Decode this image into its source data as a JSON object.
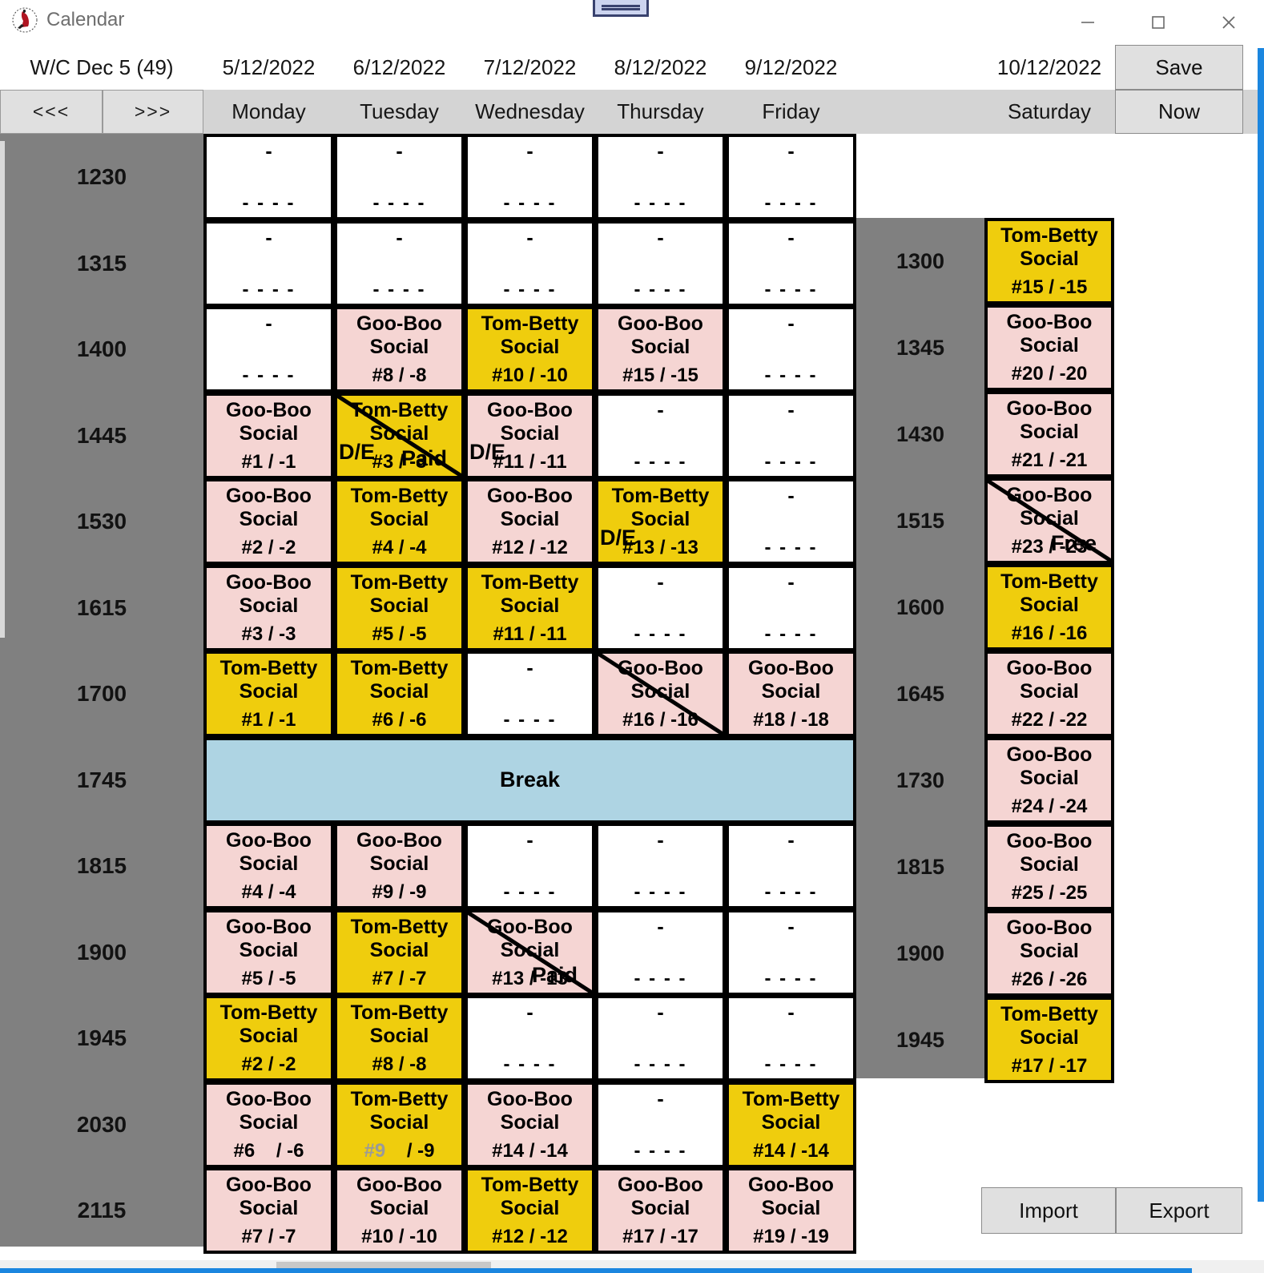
{
  "window": {
    "title": "Calendar",
    "minimize": "minimize-icon",
    "maximize": "maximize-icon",
    "close": "close-icon"
  },
  "header": {
    "week_label": "W/C Dec 5 (49)",
    "prev_label": "<<<",
    "next_label": ">>>",
    "save_label": "Save",
    "now_label": "Now",
    "import_label": "Import",
    "export_label": "Export",
    "dates": [
      "5/12/2022",
      "6/12/2022",
      "7/12/2022",
      "8/12/2022",
      "9/12/2022",
      "10/12/2022"
    ],
    "days": [
      "Monday",
      "Tuesday",
      "Wednesday",
      "Thursday",
      "Friday",
      "Saturday"
    ]
  },
  "weekday_times": [
    "1230",
    "1315",
    "1400",
    "1445",
    "1530",
    "1615",
    "1700",
    "1745",
    "1815",
    "1900",
    "1945",
    "2030",
    "2115"
  ],
  "saturday_times": [
    "1300",
    "1345",
    "1430",
    "1515",
    "1600",
    "1645",
    "1730",
    "1815",
    "1900",
    "1945"
  ],
  "empty_cell": {
    "title": "-",
    "num": "- - - -"
  },
  "break_label": "Break",
  "rows": [
    {
      "time": "1230",
      "cells": [
        {
          "kind": "empty"
        },
        {
          "kind": "empty"
        },
        {
          "kind": "empty"
        },
        {
          "kind": "empty"
        },
        {
          "kind": "empty"
        }
      ]
    },
    {
      "time": "1315",
      "cells": [
        {
          "kind": "empty"
        },
        {
          "kind": "empty"
        },
        {
          "kind": "empty"
        },
        {
          "kind": "empty"
        },
        {
          "kind": "empty"
        }
      ]
    },
    {
      "time": "1400",
      "cells": [
        {
          "kind": "empty"
        },
        {
          "kind": "pink",
          "title": "Goo-Boo Social",
          "num": "#8 / -8"
        },
        {
          "kind": "yellow",
          "title": "Tom-Betty Social",
          "num": "#10 / -10"
        },
        {
          "kind": "pink",
          "title": "Goo-Boo Social",
          "num": "#15 / -15"
        },
        {
          "kind": "empty"
        }
      ]
    },
    {
      "time": "1445",
      "cells": [
        {
          "kind": "pink",
          "title": "Goo-Boo Social",
          "num": "#1 / -1"
        },
        {
          "kind": "yellow",
          "title": "Tom-Betty Social",
          "num": "#3 / -3",
          "strike": true,
          "tag_left": "D/E",
          "tag_right": "Paid"
        },
        {
          "kind": "pink",
          "title": "Goo-Boo Social",
          "num": "#11 / -11",
          "tag_left": "D/E"
        },
        {
          "kind": "empty"
        },
        {
          "kind": "empty"
        }
      ]
    },
    {
      "time": "1530",
      "cells": [
        {
          "kind": "pink",
          "title": "Goo-Boo Social",
          "num": "#2 / -2"
        },
        {
          "kind": "yellow",
          "title": "Tom-Betty Social",
          "num": "#4 / -4"
        },
        {
          "kind": "pink",
          "title": "Goo-Boo Social",
          "num": "#12 / -12"
        },
        {
          "kind": "yellow",
          "title": "Tom-Betty Social",
          "num": "#13 / -13",
          "tag_left": "D/E"
        },
        {
          "kind": "empty"
        }
      ]
    },
    {
      "time": "1615",
      "cells": [
        {
          "kind": "pink",
          "title": "Goo-Boo Social",
          "num": "#3 / -3"
        },
        {
          "kind": "yellow",
          "title": "Tom-Betty Social",
          "num": "#5 / -5"
        },
        {
          "kind": "yellow",
          "title": "Tom-Betty Social",
          "num": "#11 / -11"
        },
        {
          "kind": "empty"
        },
        {
          "kind": "empty"
        }
      ]
    },
    {
      "time": "1700",
      "cells": [
        {
          "kind": "yellow",
          "title": "Tom-Betty Social",
          "num": "#1 / -1"
        },
        {
          "kind": "yellow",
          "title": "Tom-Betty Social",
          "num": "#6 / -6"
        },
        {
          "kind": "empty"
        },
        {
          "kind": "pink",
          "title": "Goo-Boo Social",
          "num": "#16 / -16",
          "strike": true
        },
        {
          "kind": "pink",
          "title": "Goo-Boo Social",
          "num": "#18 / -18"
        }
      ]
    },
    {
      "time": "1745",
      "break": true
    },
    {
      "time": "1815",
      "cells": [
        {
          "kind": "pink",
          "title": "Goo-Boo Social",
          "num": "#4 / -4"
        },
        {
          "kind": "pink",
          "title": "Goo-Boo Social",
          "num": "#9 / -9"
        },
        {
          "kind": "empty"
        },
        {
          "kind": "empty"
        },
        {
          "kind": "empty"
        }
      ]
    },
    {
      "time": "1900",
      "cells": [
        {
          "kind": "pink",
          "title": "Goo-Boo Social",
          "num": "#5 / -5"
        },
        {
          "kind": "yellow",
          "title": "Tom-Betty Social",
          "num": "#7 / -7"
        },
        {
          "kind": "pink",
          "title": "Goo-Boo Social",
          "num": "#13 / -13",
          "strike": true,
          "tag_right": "Paid"
        },
        {
          "kind": "empty"
        },
        {
          "kind": "empty"
        }
      ]
    },
    {
      "time": "1945",
      "cells": [
        {
          "kind": "yellow",
          "title": "Tom-Betty Social",
          "num": "#2 / -2"
        },
        {
          "kind": "yellow",
          "title": "Tom-Betty Social",
          "num": "#8 / -8"
        },
        {
          "kind": "empty"
        },
        {
          "kind": "empty"
        },
        {
          "kind": "empty"
        }
      ]
    },
    {
      "time": "2030",
      "cells": [
        {
          "kind": "pink",
          "title": "Goo-Boo Social",
          "num": "#6    / -6"
        },
        {
          "kind": "yellow",
          "title": "Tom-Betty Social",
          "num_gray": "#9",
          "num": "    / -9"
        },
        {
          "kind": "pink",
          "title": "Goo-Boo Social",
          "num": "#14 / -14"
        },
        {
          "kind": "empty"
        },
        {
          "kind": "yellow",
          "title": "Tom-Betty Social",
          "num": "#14 / -14"
        }
      ]
    },
    {
      "time": "2115",
      "cells": [
        {
          "kind": "pink",
          "title": "Goo-Boo Social",
          "num": "#7 / -7"
        },
        {
          "kind": "pink",
          "title": "Goo-Boo Social",
          "num": "#10 / -10"
        },
        {
          "kind": "yellow",
          "title": "Tom-Betty Social",
          "num": "#12 / -12"
        },
        {
          "kind": "pink",
          "title": "Goo-Boo Social",
          "num": "#17 / -17"
        },
        {
          "kind": "pink",
          "title": "Goo-Boo Social",
          "num": "#19 / -19"
        }
      ]
    }
  ],
  "saturday_rows": [
    {
      "time": "1300",
      "cell": {
        "kind": "yellow",
        "title": "Tom-Betty Social",
        "num": "#15 / -15"
      }
    },
    {
      "time": "1345",
      "cell": {
        "kind": "pink",
        "title": "Goo-Boo Social",
        "num": "#20 / -20"
      }
    },
    {
      "time": "1430",
      "cell": {
        "kind": "pink",
        "title": "Goo-Boo Social",
        "num": "#21 / -21"
      }
    },
    {
      "time": "1515",
      "cell": {
        "kind": "pink",
        "title": "Goo-Boo Social",
        "num": "#23 / -23",
        "strike": true,
        "tag_right": "Free"
      }
    },
    {
      "time": "1600",
      "cell": {
        "kind": "yellow",
        "title": "Tom-Betty Social",
        "num": "#16 / -16"
      }
    },
    {
      "time": "1645",
      "cell": {
        "kind": "pink",
        "title": "Goo-Boo Social",
        "num": "#22 / -22"
      }
    },
    {
      "time": "1730",
      "cell": {
        "kind": "pink",
        "title": "Goo-Boo Social",
        "num": "#24 / -24"
      }
    },
    {
      "time": "1815",
      "cell": {
        "kind": "pink",
        "title": "Goo-Boo Social",
        "num": "#25 / -25"
      }
    },
    {
      "time": "1900",
      "cell": {
        "kind": "pink",
        "title": "Goo-Boo Social",
        "num": "#26 / -26"
      }
    },
    {
      "time": "1945",
      "cell": {
        "kind": "yellow",
        "title": "Tom-Betty Social",
        "num": "#17 / -17"
      }
    }
  ],
  "colors": {
    "pink": "#f5d5d3",
    "yellow": "#efcd0d",
    "break": "#aed4e3",
    "time_bg": "#808080",
    "header_bg": "#d4d4d4",
    "button_bg": "#e0e0e0"
  }
}
